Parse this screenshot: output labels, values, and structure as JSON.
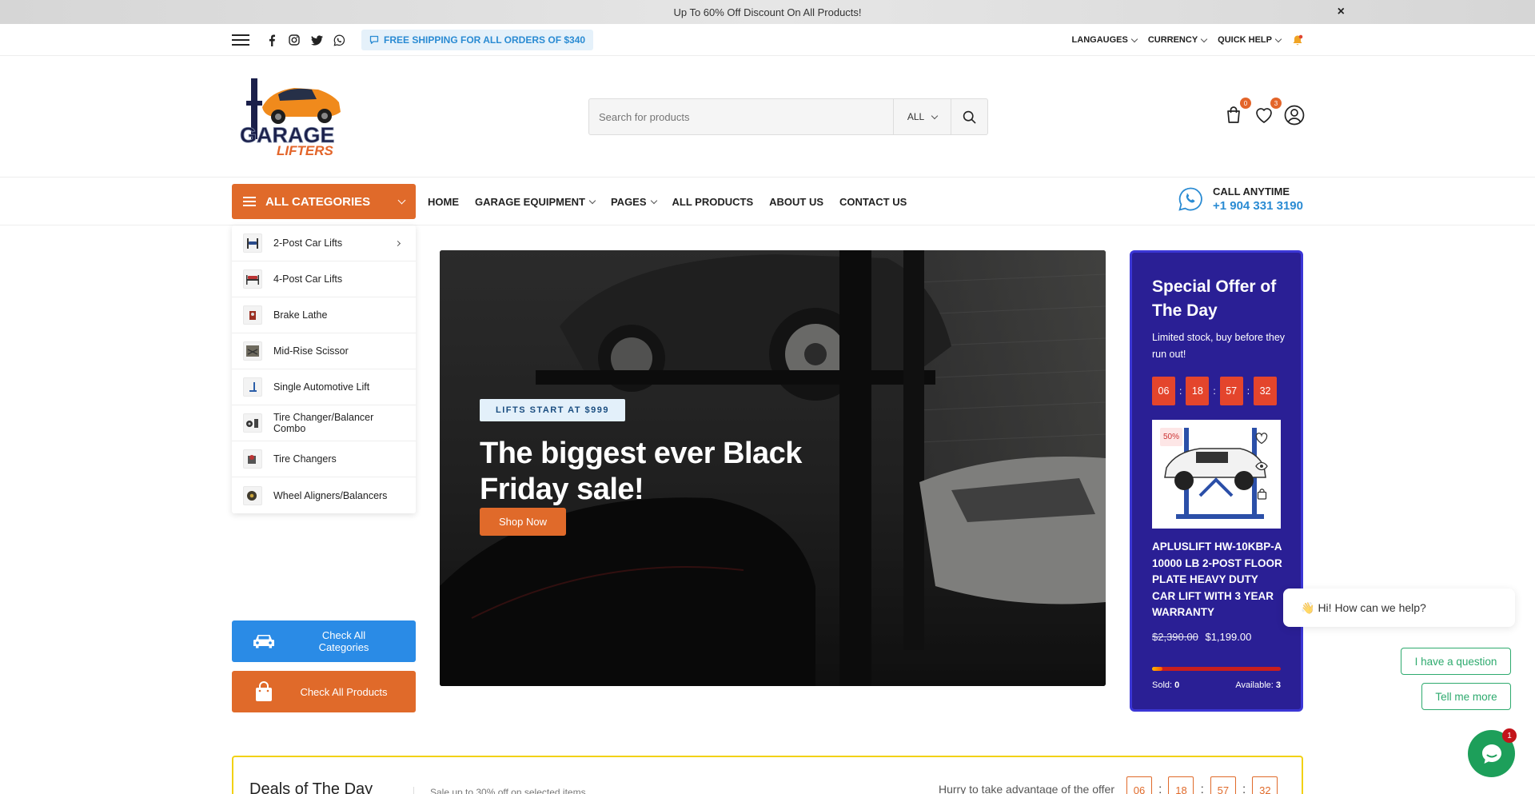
{
  "announcement": {
    "text": "Up To 60% Off Discount On All Products!",
    "close": "×"
  },
  "utility": {
    "shipping": "FREE SHIPPING FOR ALL ORDERS OF $340",
    "languages": "LANGAUGES",
    "currency": "CURRENCY",
    "quick_help": "QUICK HELP"
  },
  "search": {
    "placeholder": "Search for products",
    "category": "ALL"
  },
  "header_badges": {
    "cart": "0",
    "wishlist": "3"
  },
  "logo": {
    "line1": "GARAGE",
    "line2": "LIFTERS"
  },
  "nav": {
    "all_categories": "ALL CATEGORIES",
    "items": [
      {
        "label": "HOME"
      },
      {
        "label": "GARAGE EQUIPMENT"
      },
      {
        "label": "PAGES"
      },
      {
        "label": "ALL PRODUCTS"
      },
      {
        "label": "ABOUT US"
      },
      {
        "label": "CONTACT US"
      }
    ],
    "call_label": "CALL ANYTIME",
    "call_number": "+1 904 331 3190"
  },
  "categories": [
    {
      "label": "2-Post Car Lifts"
    },
    {
      "label": "4-Post Car Lifts"
    },
    {
      "label": "Brake Lathe"
    },
    {
      "label": "Mid-Rise Scissor"
    },
    {
      "label": "Single Automotive Lift"
    },
    {
      "label": "Tire Changer/Balancer Combo"
    },
    {
      "label": "Tire Changers"
    },
    {
      "label": "Wheel Aligners/Balancers"
    }
  ],
  "side_buttons": {
    "check_categories": "Check All Categories",
    "check_products": "Check All Products"
  },
  "hero": {
    "pill": "LIFTS START AT $999",
    "headline": "The biggest ever Black Friday sale!",
    "cta": "Shop Now"
  },
  "offer": {
    "title": "Special Offer of The Day",
    "subtitle": "Limited stock, buy before they run out!",
    "timer": [
      "06",
      "18",
      "57",
      "32"
    ],
    "sale_badge": "50%",
    "product_name": "APLUSLIFT HW-10KBP-A 10000 LB 2-POST FLOOR PLATE HEAVY DUTY CAR LIFT WITH 3 YEAR WARRANTY",
    "old_price": "$2,390.00",
    "new_price": "$1,199.00",
    "sold_label": "Sold:",
    "sold": "0",
    "available_label": "Available:",
    "available": "3",
    "progress": 0.08
  },
  "chat": {
    "greeting": "Hi! How can we help?",
    "emoji": "👋",
    "btn_question": "I have a question",
    "btn_more": "Tell me more",
    "notifications": "1"
  },
  "deals": {
    "title": "Deals of The Day",
    "subtitle": "Sale up to 30% off on selected items",
    "hurry": "Hurry to take advantage of the offer",
    "timer": [
      "06",
      "18",
      "57",
      "32"
    ]
  },
  "colors": {
    "accent": "#e06a2a",
    "blue": "#2a8bd3",
    "offer_bg": "#2a1f95"
  }
}
